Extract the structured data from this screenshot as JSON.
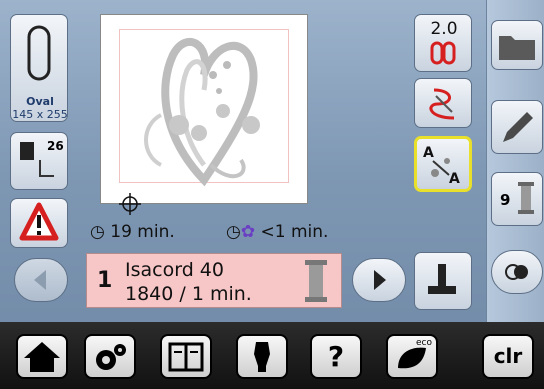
{
  "hoop": {
    "name": "Oval",
    "size": "145 x 255"
  },
  "sidebar": {
    "stitch_count": "26"
  },
  "times": {
    "total": "19 min.",
    "color_change": "<1 min."
  },
  "thread": {
    "index": "1",
    "brand": "Isacord 40",
    "detail": "1840 / 1 min."
  },
  "toolbar": {
    "zoom_value": "2.0",
    "thread_side_count": "9"
  },
  "bottom": {
    "clr_label": "clr",
    "help_label": "?",
    "eco_label": "eco"
  },
  "colors": {
    "thread_panel": "#f7c6c6",
    "accent_yellow": "#e8e02a",
    "warning_red": "#d62020"
  }
}
